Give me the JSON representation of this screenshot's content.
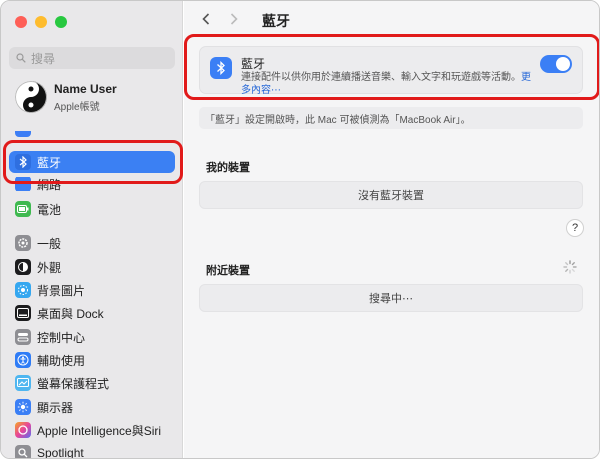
{
  "sidebar": {
    "search_placeholder": "搜尋",
    "user": {
      "name": "Name User",
      "subtitle": "Apple帳號"
    },
    "items": [
      {
        "label": "藍牙",
        "icon": "bluetooth-icon",
        "color": "#3b7ff5",
        "selected": true
      },
      {
        "label": "網路",
        "icon": "network-icon",
        "color": "#3b7ff5"
      },
      {
        "label": "電池",
        "icon": "battery-icon",
        "color": "#3fb950"
      },
      {
        "label": "一般",
        "icon": "gear-icon",
        "color": "#8e8e93"
      },
      {
        "label": "外觀",
        "icon": "appearance-icon",
        "color": "#1c1c1e"
      },
      {
        "label": "背景圖片",
        "icon": "wallpaper-icon",
        "color": "#35a7f0"
      },
      {
        "label": "桌面與 Dock",
        "icon": "dock-icon",
        "color": "#1c1c1e"
      },
      {
        "label": "控制中心",
        "icon": "control-center-icon",
        "color": "#8e8e93"
      },
      {
        "label": "輔助使用",
        "icon": "accessibility-icon",
        "color": "#2f7cf6"
      },
      {
        "label": "螢幕保護程式",
        "icon": "screensaver-icon",
        "color": "#4fb6f0"
      },
      {
        "label": "顯示器",
        "icon": "display-icon",
        "color": "#3b7ff5"
      },
      {
        "label": "Apple Intelligence與Siri",
        "icon": "siri-icon",
        "color": "#e86a4f"
      },
      {
        "label": "Spotlight",
        "icon": "spotlight-icon",
        "color": "#8e8e93"
      }
    ]
  },
  "header": {
    "title": "藍牙"
  },
  "bluetooth": {
    "title": "藍牙",
    "description": "連接配件以供你用於連續播送音樂、輸入文字和玩遊戲等活動。",
    "more": "更多內容⋯",
    "enabled": true
  },
  "discoverable_note": "「藍牙」設定開啟時，此 Mac 可被偵測為「MacBook Air」。",
  "my_devices": {
    "title": "我的裝置",
    "empty": "沒有藍牙裝置"
  },
  "help_label": "?",
  "nearby": {
    "title": "附近裝置",
    "status": "搜尋中⋯"
  }
}
